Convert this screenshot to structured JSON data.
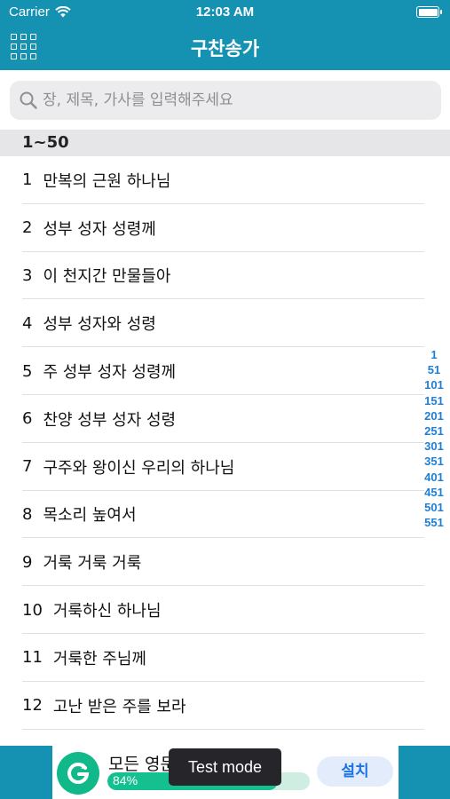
{
  "status": {
    "carrier": "Carrier",
    "time": "12:03 AM"
  },
  "nav": {
    "title": "구찬송가",
    "menu_icon": "grid-icon"
  },
  "search": {
    "placeholder": "장, 제목, 가사를 입력해주세요"
  },
  "section": {
    "title": "1~50"
  },
  "hymns": [
    {
      "num": "1",
      "title": "만복의 근원 하나님"
    },
    {
      "num": "2",
      "title": "성부 성자 성령께"
    },
    {
      "num": "3",
      "title": "이 천지간 만물들아"
    },
    {
      "num": "4",
      "title": "성부 성자와 성령"
    },
    {
      "num": "5",
      "title": "주 성부 성자 성령께"
    },
    {
      "num": "6",
      "title": "찬양 성부 성자 성령"
    },
    {
      "num": "7",
      "title": "구주와 왕이신 우리의 하나님"
    },
    {
      "num": "8",
      "title": "목소리 높여서"
    },
    {
      "num": "9",
      "title": "거룩 거룩 거룩"
    },
    {
      "num": "10",
      "title": "거룩하신 하나님"
    },
    {
      "num": "11",
      "title": "거룩한 주님께"
    },
    {
      "num": "12",
      "title": "고난 받은 주를 보라"
    }
  ],
  "index": [
    "1",
    "51",
    "101",
    "151",
    "201",
    "251",
    "301",
    "351",
    "401",
    "451",
    "501",
    "551"
  ],
  "ad": {
    "title": "모든 영문",
    "progress_label": "84%",
    "progress": 0.84,
    "install_label": "설치",
    "toast": "Test mode"
  },
  "colors": {
    "brand": "#1591b2",
    "index": "#1e7fd6",
    "ad_accent": "#14c08f"
  }
}
